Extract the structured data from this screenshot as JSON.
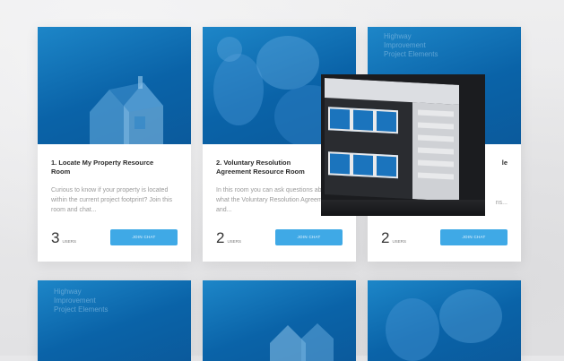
{
  "cards": [
    {
      "title": "1. Locate My Property Resource\nRoom",
      "description": "Curious to know if your property is located within the current project footprint? Join this room and chat...",
      "count": "3",
      "count_label": "USERS",
      "button": "JOIN CHAT"
    },
    {
      "title": "2. Voluntary Resolution\nAgreement Resource Room",
      "description": "In this room you can ask questions about what the Voluntary Resolution Agreement is and...",
      "count": "2",
      "count_label": "USERS",
      "button": "JOIN CHAT"
    },
    {
      "title": "",
      "title_tail": "le",
      "description_tail": "ns...",
      "count": "2",
      "count_label": "USERS",
      "button": "JOIN CHAT"
    }
  ],
  "image_overlays": {
    "card3_top": "Highway\nImprovement\nProject Elements",
    "card4_top": "Highway\nImprovement\nProject Elements"
  },
  "colors": {
    "card_blue": "#0a63a8",
    "button_blue": "#3fa9e6"
  }
}
